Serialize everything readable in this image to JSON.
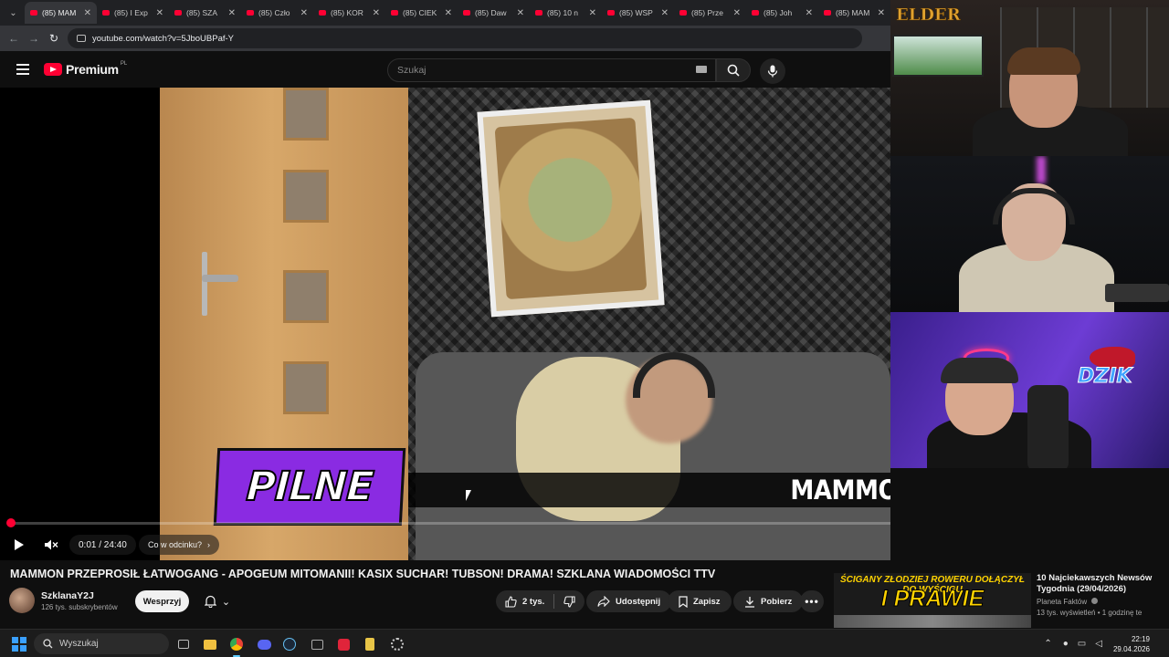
{
  "browser": {
    "tabs": [
      {
        "label": "(85) MAM",
        "active": true
      },
      {
        "label": "(85) I Exp",
        "active": false
      },
      {
        "label": "(85) SZA",
        "active": false
      },
      {
        "label": "(85) Czło",
        "active": false
      },
      {
        "label": "(85) KOR",
        "active": false
      },
      {
        "label": "(85) CIEK",
        "active": false
      },
      {
        "label": "(85) Daw",
        "active": false
      },
      {
        "label": "(85) 10 n",
        "active": false
      },
      {
        "label": "(85) WSP",
        "active": false
      },
      {
        "label": "(85) Prze",
        "active": false
      },
      {
        "label": "(85) Joh",
        "active": false
      },
      {
        "label": "(85) MAM",
        "active": false
      }
    ],
    "url": "youtube.com/watch?v=5JboUBPaf-Y"
  },
  "yt": {
    "logo_text": "Premium",
    "logo_region": "PL",
    "search_placeholder": "Szukaj",
    "brand_color": "#ff0033"
  },
  "video": {
    "pilne_label": "PILNE",
    "ticker_text": "MAMMON PRZE",
    "time_current": "0:01",
    "time_total": "24:40",
    "time_display": "0:01 / 24:40",
    "progress_fraction": 0.001,
    "chapter_label": "Co w odcinku?"
  },
  "meta": {
    "title": "MAMMON PRZEPROSIŁ ŁATWOGANG - APOGEUM MITOMANII! KASIX SUCHAR! TUBSON! DRAMA! SZKLANA WIADOMOŚCI TTV",
    "channel_name": "SzklanaY2J",
    "subscribers": "126 tys. subskrybentów",
    "support_label": "Wesprzyj",
    "likes": "2 tys.",
    "share_label": "Udostępnij",
    "save_label": "Zapisz",
    "download_label": "Pobierz"
  },
  "recommendation": {
    "thumb_line1": "ŚCIGANY ZŁODZIEJ ROWERU DOŁĄCZYŁ DO WYŚCIGU",
    "thumb_line2": "I PRAWIE WYGRAŁ",
    "title": "10 Najciekawszych Newsów Tygodnia (29/04/2026)",
    "channel": "Planeta Faktów",
    "meta": "13 tys. wyświetleń • 1 godzinę te"
  },
  "overlay": {
    "cam1_logo": "ELDER",
    "cam3_logo": "DZIK"
  },
  "taskbar": {
    "search_placeholder": "Wyszukaj",
    "time": "22:19",
    "date": "29.04.2026"
  }
}
